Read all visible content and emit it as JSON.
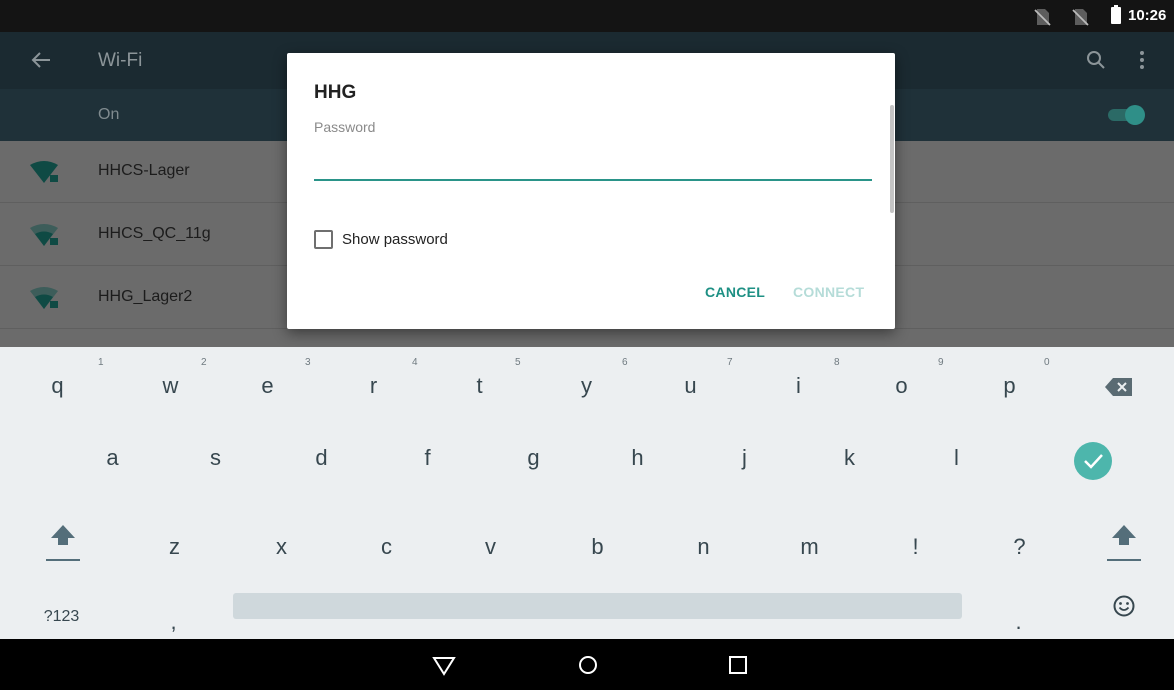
{
  "status_bar": {
    "time": "10:26",
    "icons": [
      "no-sim-icon",
      "no-sim-icon",
      "battery-icon"
    ]
  },
  "app_bar": {
    "title": "Wi-Fi",
    "icons": [
      "back-arrow-icon",
      "search-icon",
      "more-vert-icon"
    ]
  },
  "wifi_switch": {
    "label": "On",
    "state": "on"
  },
  "networks": [
    {
      "name": "HHCS-Lager",
      "secured": true
    },
    {
      "name": "HHCS_QC_11g",
      "secured": true
    },
    {
      "name": "HHG_Lager2",
      "secured": true
    }
  ],
  "dialog": {
    "title": "HHG",
    "password_label": "Password",
    "password_value": "",
    "show_password_label": "Show password",
    "show_password_checked": false,
    "cancel_label": "CANCEL",
    "connect_label": "CONNECT",
    "connect_enabled": false
  },
  "keyboard": {
    "row1": [
      {
        "key": "q",
        "hint": "1"
      },
      {
        "key": "w",
        "hint": "2"
      },
      {
        "key": "e",
        "hint": "3"
      },
      {
        "key": "r",
        "hint": "4"
      },
      {
        "key": "t",
        "hint": "5"
      },
      {
        "key": "y",
        "hint": "6"
      },
      {
        "key": "u",
        "hint": "7"
      },
      {
        "key": "i",
        "hint": "8"
      },
      {
        "key": "o",
        "hint": "9"
      },
      {
        "key": "p",
        "hint": "0"
      }
    ],
    "row2": [
      "a",
      "s",
      "d",
      "f",
      "g",
      "h",
      "j",
      "k",
      "l"
    ],
    "row3": [
      "z",
      "x",
      "c",
      "v",
      "b",
      "n",
      "m",
      "!",
      "?"
    ],
    "symbols_label": "?123",
    "comma": ",",
    "period": "."
  },
  "colors": {
    "accent": "#2a9489",
    "accent_disabled": "#b5dcd8",
    "keyboard_bg": "#eceff1",
    "enter_key": "#4db6ac"
  }
}
